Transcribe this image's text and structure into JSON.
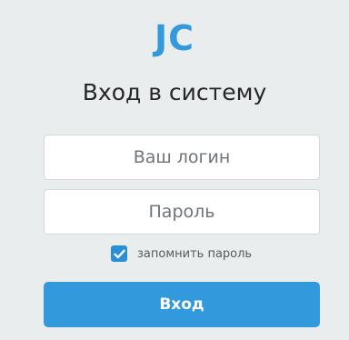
{
  "logo": {
    "text": "JC"
  },
  "title": "Вход в систему",
  "login": {
    "value": "",
    "placeholder": "Ваш логин"
  },
  "password": {
    "value": "",
    "placeholder": "Пароль"
  },
  "remember": {
    "label": "запомнить пароль",
    "checked": true,
    "icon": "checkmark-icon"
  },
  "submit": {
    "label": "Вход"
  },
  "colors": {
    "background": "#e9edee",
    "accent": "#3399dd",
    "checkbox": "#2b8fd6",
    "title_text": "#262626"
  }
}
